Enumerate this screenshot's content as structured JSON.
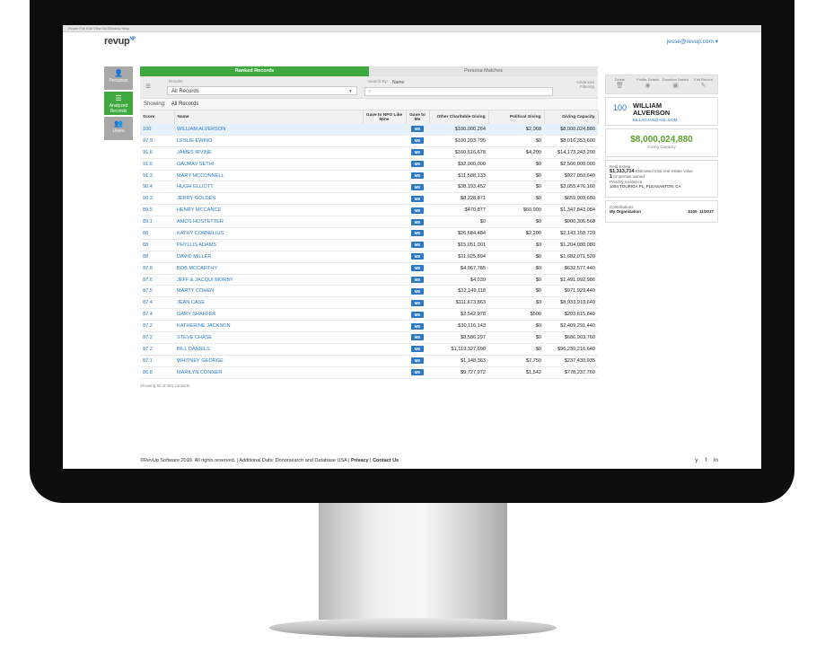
{
  "os_menu": "Finder  File  Edit  View  Go  Window  Help",
  "app": {
    "logo": "revup",
    "logo_suffix": "NP",
    "user_email": "jesse@revup.com ▾"
  },
  "sidebar": {
    "items": [
      {
        "label": "Personas",
        "icon": "person-icon"
      },
      {
        "label": "Analyzed Records",
        "icon": "list-icon"
      },
      {
        "label": "Users",
        "icon": "users-icon"
      }
    ]
  },
  "tabs": [
    {
      "label": "Ranked Records"
    },
    {
      "label": "Persona Matches"
    }
  ],
  "filter": {
    "results_label": "Results:",
    "results_value": "All Records",
    "search_by_label": "Search By:",
    "search_by_value": "Name",
    "advanced_label": "Advanced Filtering"
  },
  "showing": {
    "label": "Showing:",
    "value": "All Records"
  },
  "table": {
    "headers": [
      "Score",
      "Name",
      "Gave to NPO Like Mine",
      "Gave to Me",
      "Other Charitable Giving",
      "Political Giving",
      "Giving Capacity"
    ],
    "rows": [
      [
        "100",
        "WILLIAM ALVERSON",
        "",
        "ME",
        "$100,000,264",
        "$2,068",
        "$8,000,024,880"
      ],
      [
        "97.9",
        "LESLIE EWING",
        "",
        "ME",
        "$100,203,795",
        "$0",
        "$8,016,353,600"
      ],
      [
        "91.6",
        "JAMES IRVINE",
        "",
        "ME",
        "$160,616,678",
        "$4,200",
        "$14,173,243,200"
      ],
      [
        "91.6",
        "GAURAV SETHI",
        "",
        "ME",
        "$32,000,000",
        "$0",
        "$2,560,000,000"
      ],
      [
        "91.3",
        "MARY MCCONNELL",
        "",
        "ME",
        "$11,588,133",
        "$0",
        "$927,050,640"
      ],
      [
        "90.4",
        "HUGH ELLIOTT",
        "",
        "ME",
        "$38,193,452",
        "$0",
        "$3,055,476,160"
      ],
      [
        "90.3",
        "JERRY GOLDEN",
        "",
        "ME",
        "$8,228,871",
        "$0",
        "$659,909,680"
      ],
      [
        "89.5",
        "HENRY MCCANCE",
        "",
        "ME",
        "$470,877",
        "$60,900",
        "$1,347,843,084"
      ],
      [
        "89.1",
        "AMOS HOSTETTER",
        "",
        "ME",
        "$0",
        "$0",
        "$900,306,568"
      ],
      [
        "88",
        "KATHY CORNELIUS",
        "",
        "ME",
        "$26,684,484",
        "$2,200",
        "$2,143,158,720"
      ],
      [
        "88",
        "PHYLLIS ADAMS",
        "",
        "ME",
        "$15,051,001",
        "$0",
        "$1,204,080,080"
      ],
      [
        "88",
        "DAVID MILLER",
        "",
        "ME",
        "$11,025,894",
        "$0",
        "$1,682,071,520"
      ],
      [
        "87.8",
        "BOB MCCARTHY",
        "",
        "ME",
        "$4,967,785",
        "$0",
        "$632,577,440"
      ],
      [
        "87.6",
        "JEFF & JACQUI MORBY",
        "",
        "ME",
        "$4,039",
        "$0",
        "$1,491,992,986"
      ],
      [
        "87.5",
        "MARTY COHEN",
        "",
        "ME",
        "$12,149,118",
        "$0",
        "$971,929,440"
      ],
      [
        "87.4",
        "JEAN CASE",
        "",
        "ME",
        "$111,673,863",
        "$0",
        "$8,933,910,640"
      ],
      [
        "87.4",
        "GARY SHAFFER",
        "",
        "ME",
        "$2,542,978",
        "$500",
        "$203,615,840"
      ],
      [
        "87.2",
        "KATHERINE JACKSON",
        "",
        "ME",
        "$30,116,143",
        "$0",
        "$2,409,291,440"
      ],
      [
        "87.2",
        "STEVE CHASE",
        "",
        "ME",
        "$8,586,297",
        "$0",
        "$686,903,760"
      ],
      [
        "87.2",
        "BILL DANIELS",
        "",
        "ME",
        "$1,119,327,698",
        "$0",
        "$96,230,216,640"
      ],
      [
        "87.1",
        "WHITNEY GEORGE",
        "",
        "ME",
        "$1,148,363",
        "$7,750",
        "$237,430,935"
      ],
      [
        "86.8",
        "MARILYN CONNER",
        "",
        "ME",
        "$9,727,972",
        "$1,542",
        "$778,237,760"
      ]
    ],
    "count_text": "Showing 50 of 381 contacts"
  },
  "right_panel": {
    "tools": [
      {
        "label": "Delete",
        "icon": "delete-icon"
      },
      {
        "label": "Profile Details",
        "icon": "profile-icon"
      },
      {
        "label": "Donation Details",
        "icon": "donation-icon"
      },
      {
        "label": "Edit Record",
        "icon": "edit-icon"
      }
    ],
    "score": "100",
    "name": "WILLIAM ALVERSON",
    "email": "BILLANJAN@AOL.COM",
    "capacity": "$8,000,024,880",
    "capacity_label": "Giving Capacity",
    "real_estate_label": "Real Estate",
    "real_estate_value": "$1,313,714",
    "real_estate_desc": "Estimated total real estate value",
    "properties": "1",
    "properties_desc": "properties owned",
    "primary_label": "Primary residence",
    "primary_value": "1094 TOURIGA PL, PLEASANTON, CA",
    "contrib_label": "Contributions",
    "contrib_org": "My Organization",
    "contrib_amount": "$100",
    "contrib_date": "11/2017"
  },
  "footer": {
    "text": "©RevUp Software 2019. All rights reserved.  |  Additional Data: Donorsearch and Database USA  |",
    "privacy": "Privacy",
    "contact": "Contact Us",
    "social": "y f in"
  }
}
